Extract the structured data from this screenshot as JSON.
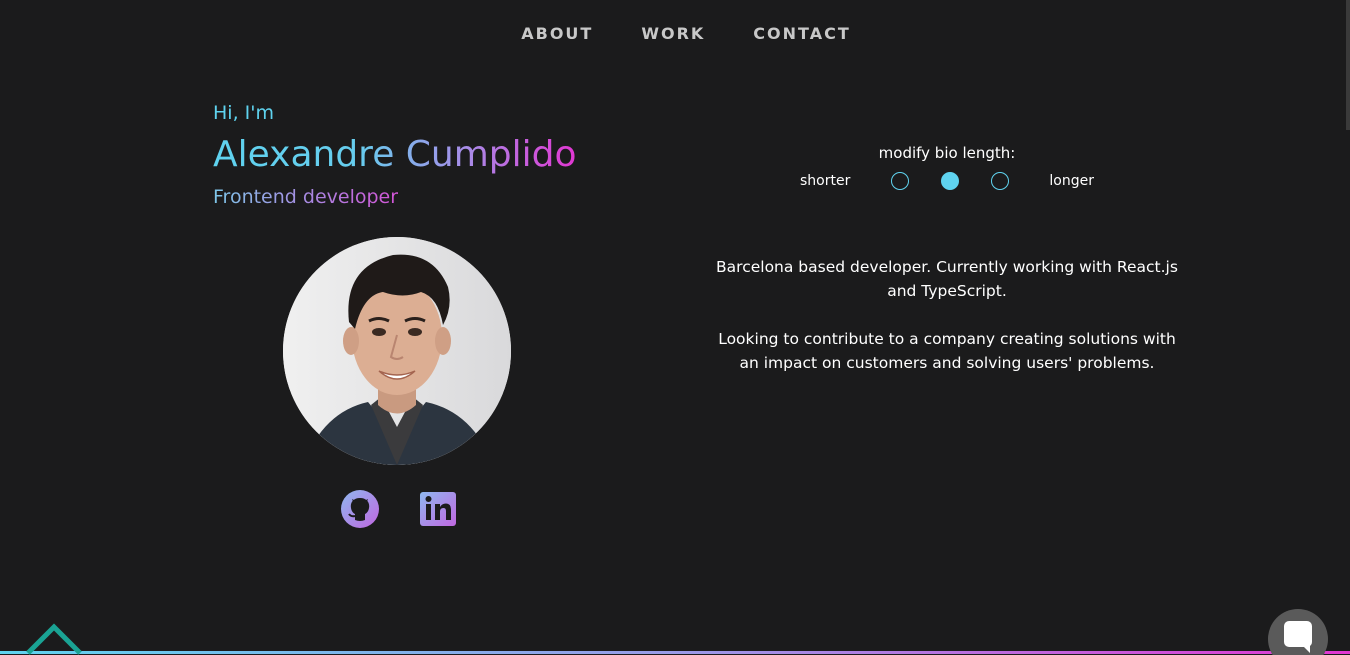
{
  "nav": {
    "about": "ABOUT",
    "work": "WORK",
    "contact": "CONTACT"
  },
  "hero": {
    "greeting": "Hi, I'm",
    "name": "Alexandre Cumplido",
    "role": "Frontend developer"
  },
  "bio_control": {
    "title": "modify bio length:",
    "shorter_label": "shorter",
    "longer_label": "longer",
    "options": 3,
    "selected_index": 1
  },
  "bio": {
    "paragraph_1": "Barcelona based developer. Currently working with React.js and TypeScript.",
    "paragraph_2": "Looking to contribute to a company creating solutions with an impact on customers and solving users' problems."
  },
  "socials": {
    "github_icon": "github-icon",
    "linkedin_icon": "linkedin-icon"
  },
  "colors": {
    "background": "#1b1b1c",
    "accent_cyan": "#5fd3ef",
    "accent_magenta": "#e236d2",
    "nav_text": "#c8c8c8"
  }
}
